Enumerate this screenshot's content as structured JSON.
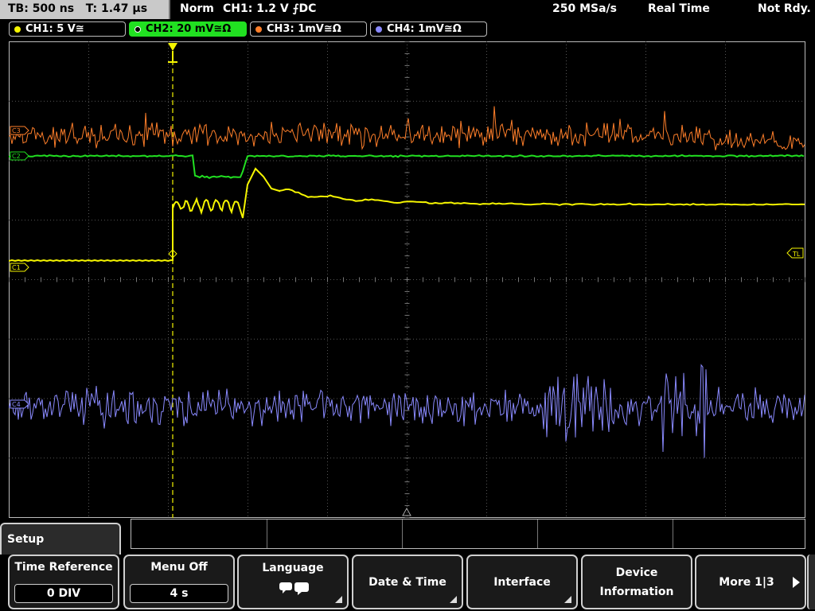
{
  "status": {
    "timebase": "TB: 500 ns",
    "trigger_time": "T: 1.47 µs",
    "mode": "Norm",
    "trigger_info": "CH1: 1.2 V ⨍DC",
    "sample_rate": "250 MSa/s",
    "acq_mode": "Real Time",
    "state": "Not Rdy."
  },
  "channels": [
    {
      "label": "CH1: 5 V≅",
      "color": "#f5f500"
    },
    {
      "label": "CH2: 20 mV≅Ω",
      "color": "#21e021"
    },
    {
      "label": "CH3: 1mV≅Ω",
      "color": "#ff7f2a"
    },
    {
      "label": "CH4: 1mV≅Ω",
      "color": "#8a8aff"
    }
  ],
  "markers": {
    "ch1": "C1",
    "ch2": "C2",
    "ch3": "C3",
    "ch4": "C4",
    "trigger_level": "TL",
    "trigger_pos": "T"
  },
  "menu": {
    "title": "Setup",
    "time_reference_label": "Time Reference",
    "time_reference_value": "0 DIV",
    "menu_off_label": "Menu Off",
    "menu_off_value": "4 s",
    "language_label": "Language",
    "date_time_label": "Date & Time",
    "interface_label": "Interface",
    "device_info_label_1": "Device",
    "device_info_label_2": "Information",
    "more_label": "More 1|3"
  },
  "colors": {
    "ch1": "#f5f500",
    "ch2": "#21e021",
    "ch3": "#ff7f2a",
    "ch4": "#8a8aff",
    "grid": "#555555"
  },
  "icons": {
    "language": "speech-bubble-icon",
    "more": "arrow-right-icon"
  }
}
